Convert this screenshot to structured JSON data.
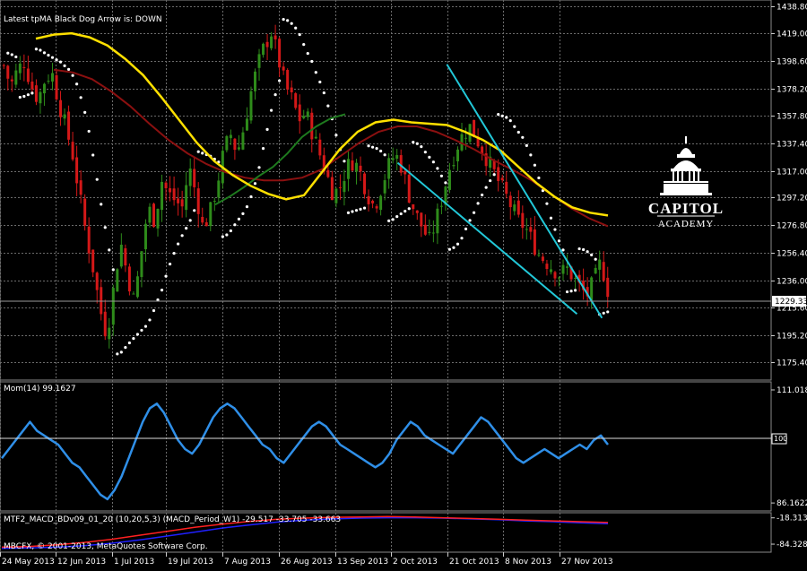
{
  "colors": {
    "background": "#000000",
    "grid": "#6b6b6b",
    "bull_candle": "#2e8b1a",
    "bear_candle": "#d41818",
    "yellow_ma": "#ffe000",
    "red_ma": "#8b1010",
    "green_ma": "#1e7a1e",
    "sar_dots": "#ffffff",
    "channel": "#22c8d8",
    "momentum": "#2f8fe8",
    "macd_red": "#ff2020",
    "macd_blue": "#2020ff"
  },
  "texts": {
    "main_label": "Latest tpMA Black Dog Arrow is:  DOWN",
    "mom_label": "Mom(14) 99.1627",
    "macd_label": "MTF2_MACD_BDv09_01_20 (10,20,5,3)  (MACD_Period_W1) -29.517 -33.705 -33.663",
    "copyright": "MBCFX, © 2001-2013, MetaQuotes Software Corp.",
    "current_price": "1229.33",
    "mom_level": "100",
    "logo_line1": "CAPITOL",
    "logo_line2": "ACADEMY"
  },
  "chart_data": [
    {
      "type": "candlestick",
      "name": "price",
      "y_ticks": [
        "1438.80",
        "1419.00",
        "1398.60",
        "1378.20",
        "1357.80",
        "1337.40",
        "1317.00",
        "1297.20",
        "1276.80",
        "1256.40",
        "1236.00",
        "1215.60",
        "1195.20",
        "1175.40"
      ],
      "ylim": [
        1166,
        1441
      ],
      "current_price": 1229.33,
      "x_ticks": [
        "24 May 2013",
        "12 Jun 2013",
        "1 Jul 2013",
        "19 Jul 2013",
        "7 Aug 2013",
        "26 Aug 2013",
        "13 Sep 2013",
        "2 Oct 2013",
        "21 Oct 2013",
        "8 Nov 2013",
        "27 Nov 2013"
      ],
      "close_path": [
        1395,
        1380,
        1392,
        1398,
        1380,
        1370,
        1385,
        1390,
        1368,
        1350,
        1330,
        1300,
        1270,
        1245,
        1215,
        1195,
        1230,
        1265,
        1240,
        1220,
        1255,
        1290,
        1280,
        1310,
        1300,
        1295,
        1290,
        1320,
        1300,
        1275,
        1285,
        1305,
        1330,
        1345,
        1330,
        1350,
        1375,
        1395,
        1410,
        1420,
        1400,
        1380,
        1370,
        1355,
        1360,
        1345,
        1330,
        1315,
        1300,
        1305,
        1320,
        1325,
        1315,
        1300,
        1290,
        1305,
        1320,
        1330,
        1320,
        1300,
        1285,
        1275,
        1265,
        1280,
        1300,
        1320,
        1335,
        1345,
        1350,
        1340,
        1330,
        1320,
        1310,
        1300,
        1290,
        1280,
        1275,
        1265,
        1255,
        1250,
        1245,
        1240,
        1245,
        1238,
        1230,
        1225,
        1235,
        1250,
        1229
      ],
      "yellow_ma_path": [
        1415,
        1418,
        1419,
        1416,
        1410,
        1400,
        1388,
        1372,
        1355,
        1338,
        1324,
        1314,
        1306,
        1300,
        1296,
        1299,
        1316,
        1333,
        1346,
        1353,
        1355,
        1353,
        1352,
        1351,
        1346,
        1340,
        1332,
        1320,
        1308,
        1298,
        1290,
        1286,
        1284
      ],
      "red_ma_path": [
        1392,
        1390,
        1385,
        1376,
        1365,
        1352,
        1340,
        1330,
        1322,
        1316,
        1312,
        1310,
        1310,
        1312,
        1318,
        1328,
        1338,
        1346,
        1350,
        1350,
        1346,
        1340,
        1333,
        1325,
        1318,
        1310,
        1300,
        1290,
        1282,
        1276
      ],
      "green_ma_path": [
        1292,
        1298,
        1305,
        1313,
        1320,
        1330,
        1342,
        1350,
        1356,
        1359
      ],
      "upper_channel": [
        [
          1334.5,
          1396
        ],
        [
          1427.5,
          1208
        ]
      ],
      "lower_channel": [
        [
          1305,
          1323
        ],
        [
          1412.5,
          1211
        ]
      ]
    },
    {
      "type": "line",
      "name": "Mom(14)",
      "value": 99.1627,
      "y_ticks": [
        "111.0185",
        "100",
        "86.1622"
      ],
      "ylim": [
        85.2,
        112.0
      ],
      "values": [
        96,
        98,
        100,
        102,
        104,
        102,
        101,
        100,
        99,
        97,
        95,
        94,
        92,
        90,
        88,
        87,
        89,
        92,
        96,
        100,
        104,
        107,
        108,
        106,
        103,
        100,
        98,
        97,
        99,
        102,
        105,
        107,
        108,
        107,
        105,
        103,
        101,
        99,
        98,
        96,
        95,
        97,
        99,
        101,
        103,
        104,
        103,
        101,
        99,
        98,
        97,
        96,
        95,
        94,
        95,
        97,
        100,
        102,
        104,
        103,
        101,
        100,
        99,
        98,
        97,
        99,
        101,
        103,
        105,
        104,
        102,
        100,
        98,
        96,
        95,
        96,
        97,
        98,
        97,
        96,
        97,
        98,
        99,
        98,
        100,
        101,
        99
      ]
    },
    {
      "type": "line",
      "name": "MTF2_MACD",
      "values_shown": [
        -29.517,
        -33.705,
        -33.663
      ],
      "y_ticks": [
        "-18.313",
        "-84.328"
      ],
      "red_line": [
        -92,
        -90,
        -86,
        -80,
        -72,
        -62,
        -52,
        -42,
        -34,
        -27,
        -22,
        -19,
        -17,
        -16,
        -15,
        -16,
        -18,
        -20,
        -22,
        -24,
        -26,
        -28,
        -30
      ],
      "blue_line": [
        -95,
        -94,
        -92,
        -88,
        -82,
        -74,
        -64,
        -54,
        -44,
        -36,
        -29,
        -24,
        -21,
        -19,
        -18,
        -18,
        -19,
        -21,
        -23,
        -26,
        -28,
        -31,
        -33
      ]
    }
  ]
}
